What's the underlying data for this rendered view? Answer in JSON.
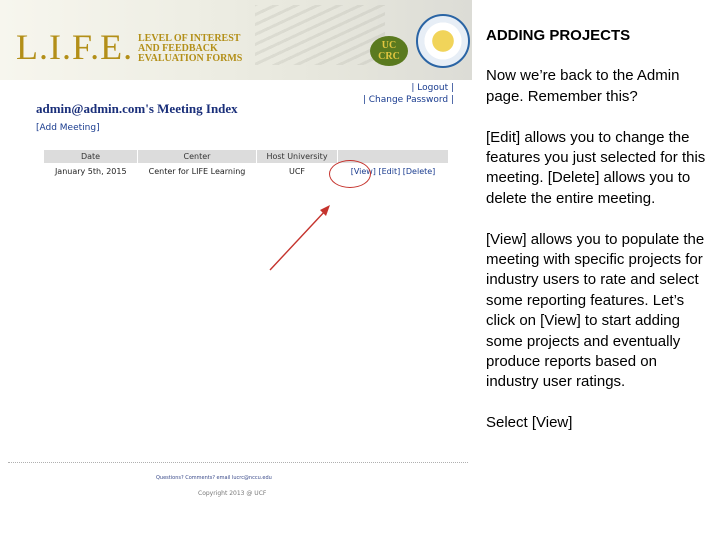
{
  "banner": {
    "logo_text": "L.I.F.E.",
    "logo_subtitle_lines": [
      "LEVEL OF INTEREST",
      "AND FEEDBACK",
      "EVALUATION FORMS"
    ],
    "ucrc_badge_lines": [
      "UC",
      "CRC"
    ]
  },
  "top_links": {
    "logout": "| Logout |",
    "change_password": "| Change Password |"
  },
  "page": {
    "title": "admin@admin.com's Meeting Index",
    "add_meeting": "[Add Meeting]"
  },
  "table": {
    "headers": [
      "Date",
      "Center",
      "Host University",
      ""
    ],
    "rows": [
      {
        "date": "January 5th, 2015",
        "center": "Center for LIFE Learning",
        "host": "UCF",
        "view": "[View]",
        "edit": "[Edit]",
        "delete": "[Delete]"
      }
    ]
  },
  "footer": {
    "questions": "Questions? Comments? email lucrc@nccu.edu",
    "copyright": "Copyright 2013 @ UCF"
  },
  "colors": {
    "link": "#1a3c8f",
    "gold": "#b38f18",
    "annotation_red": "#c5332d"
  },
  "panel": {
    "heading": "ADDING PROJECTS",
    "paragraphs": [
      "Now we’re back to the Admin page. Remember this?",
      "[Edit] allows you to change the features you just selected for this meeting. [Delete] allows you to delete the entire meeting.",
      "[View] allows you to populate the meeting with specific projects for industry users to rate and select some reporting features. Let’s click on [View] to start adding some projects and eventually produce reports based on industry user ratings.",
      "Select [View]"
    ]
  }
}
